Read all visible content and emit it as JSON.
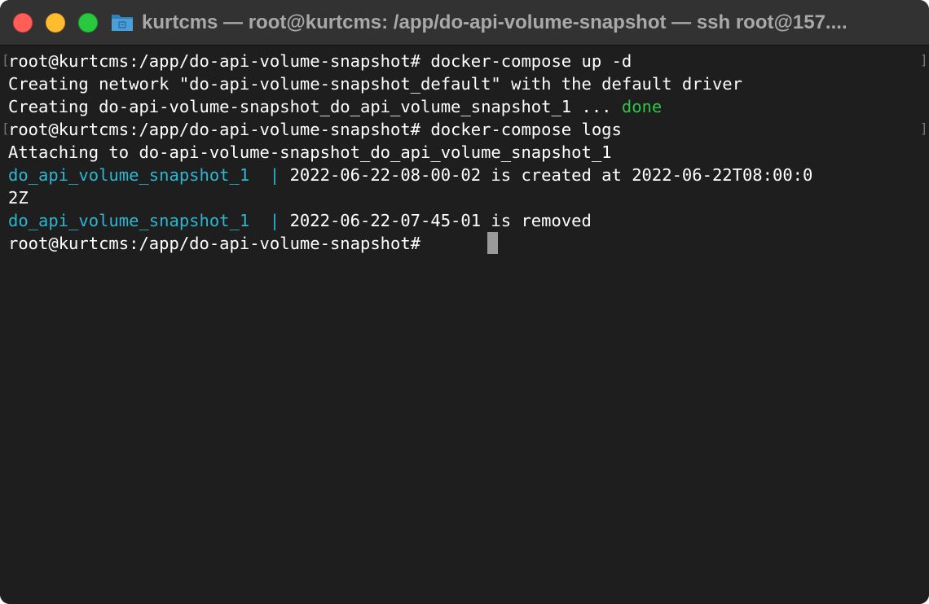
{
  "window": {
    "title": "kurtcms — root@kurtcms: /app/do-api-volume-snapshot — ssh root@157...."
  },
  "terminal": {
    "lines": [
      {
        "text": "root@kurtcms:/app/do-api-volume-snapshot# docker-compose up -d"
      },
      {
        "text": "Creating network \"do-api-volume-snapshot_default\" with the default driver"
      },
      {
        "text": "Creating do-api-volume-snapshot_do_api_volume_snapshot_1 ... ",
        "status": "done"
      },
      {
        "text": "root@kurtcms:/app/do-api-volume-snapshot# docker-compose logs"
      },
      {
        "text": "Attaching to do-api-volume-snapshot_do_api_volume_snapshot_1"
      },
      {
        "service": "do_api_volume_snapshot_1  | ",
        "text": "2022-06-22-08-00-02 is created at 2022-06-22T08:00:0"
      },
      {
        "text": "2Z"
      },
      {
        "service": "do_api_volume_snapshot_1  | ",
        "text": "2022-06-22-07-45-01 is removed"
      },
      {
        "text": "root@kurtcms:/app/do-api-volume-snapshot# "
      }
    ],
    "mark_open": "[",
    "mark_close": "]"
  },
  "colors": {
    "background": "#1e1e1e",
    "titlebar": "#323232",
    "text": "#ffffff",
    "success": "#2fc54b",
    "service_prefix": "#2ab7d1"
  }
}
